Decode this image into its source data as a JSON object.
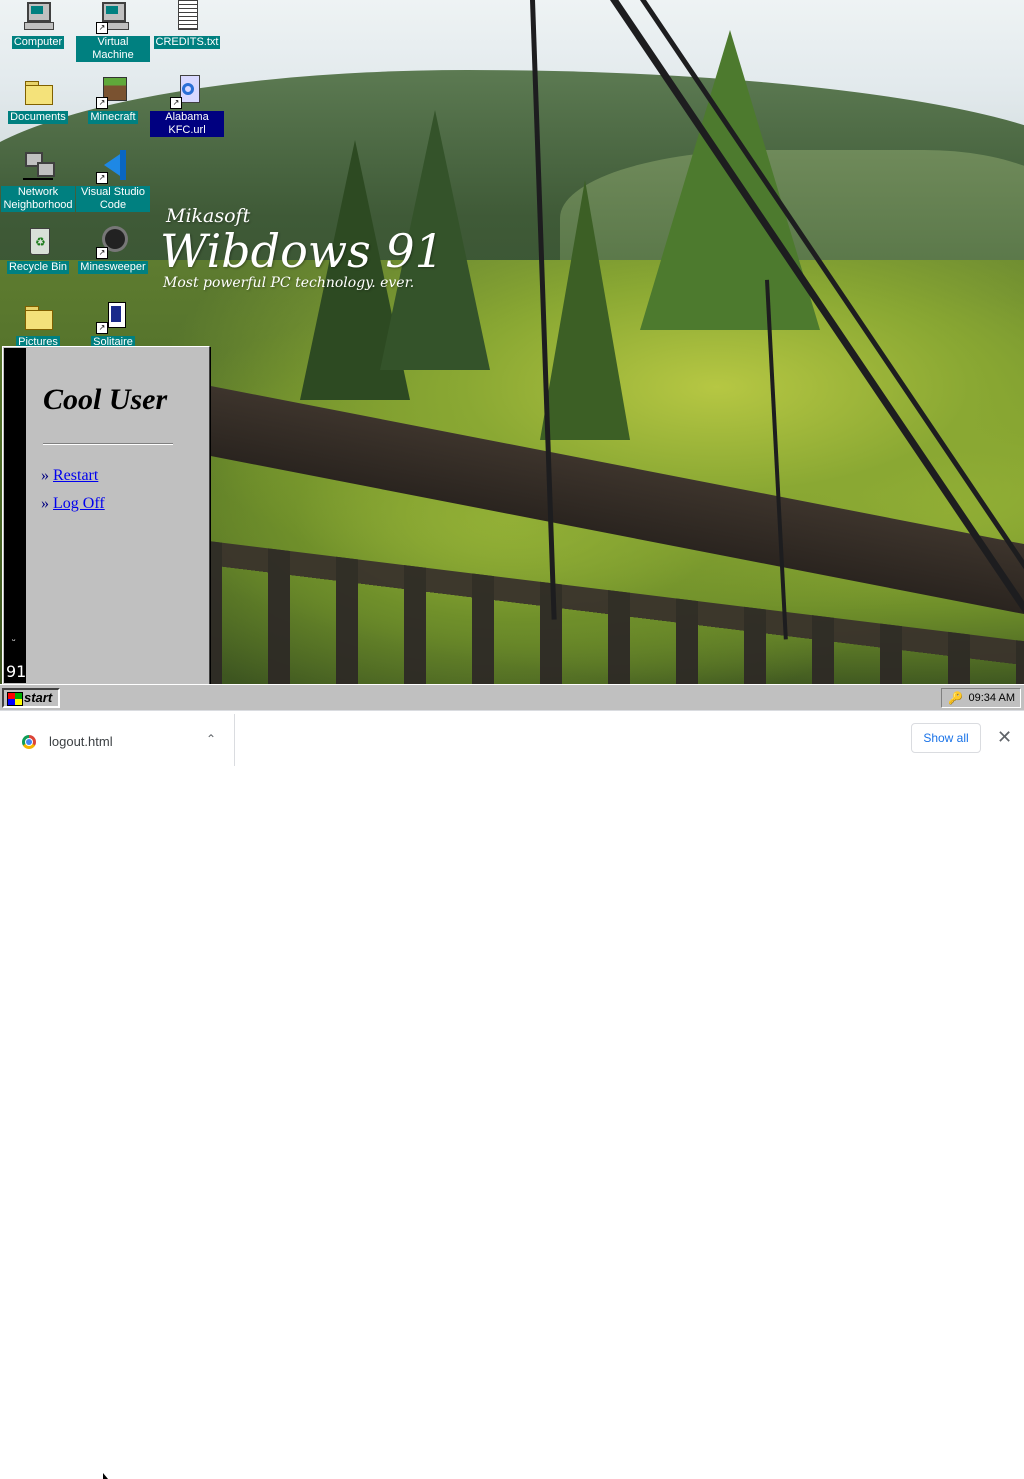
{
  "desktop": {
    "icons": [
      {
        "label": "Computer",
        "icon": "computer-icon"
      },
      {
        "label": "Virtual Machine",
        "icon": "virtual-machine-icon"
      },
      {
        "label": "CREDITS.txt",
        "icon": "text-file-icon"
      },
      {
        "label": "Documents",
        "icon": "folder-icon"
      },
      {
        "label": "Minecraft",
        "icon": "minecraft-icon"
      },
      {
        "label": "Alabama KFC.url",
        "icon": "internet-shortcut-icon"
      },
      {
        "label": "Network Neighborhood",
        "icon": "network-icon"
      },
      {
        "label": "Visual Studio Code",
        "icon": "vscode-icon"
      },
      {
        "label": "Recycle Bin",
        "icon": "recycle-bin-icon"
      },
      {
        "label": "Minesweeper",
        "icon": "minesweeper-icon"
      },
      {
        "label": "Pictures",
        "icon": "folder-icon"
      },
      {
        "label": "Solitaire",
        "icon": "solitaire-icon"
      }
    ],
    "splash": {
      "brand": "Mikasoft",
      "title": "Wibdows 91",
      "tagline": "Most powerful PC technology. ever."
    }
  },
  "start_menu": {
    "user_name": "Cool User",
    "side_label": "91",
    "items": [
      {
        "bullet": "»",
        "label": "Restart"
      },
      {
        "bullet": "»",
        "label": "Log Off"
      }
    ]
  },
  "taskbar": {
    "start_label": "start",
    "clock": "09:34 AM"
  },
  "download_bar": {
    "file_name": "logout.html",
    "show_all_label": "Show all",
    "close_glyph": "✕",
    "caret_glyph": "⌃"
  }
}
